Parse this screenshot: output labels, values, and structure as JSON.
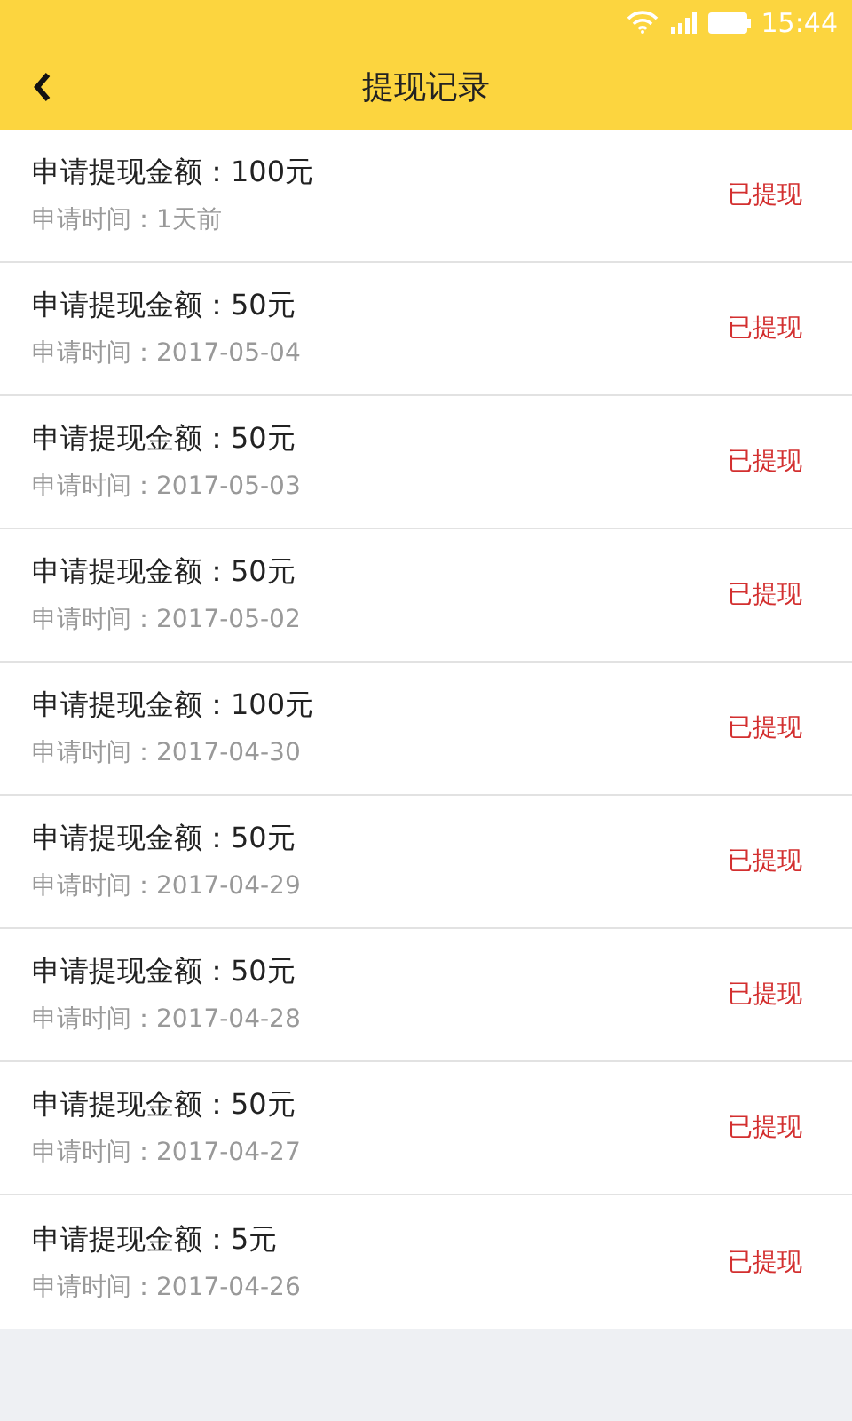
{
  "status_bar": {
    "time": "15:44"
  },
  "app_bar": {
    "title": "提现记录"
  },
  "records": [
    {
      "amount": "申请提现金额：100元",
      "time": "申请时间：1天前",
      "status": "已提现"
    },
    {
      "amount": "申请提现金额：50元",
      "time": "申请时间：2017-05-04",
      "status": "已提现"
    },
    {
      "amount": "申请提现金额：50元",
      "time": "申请时间：2017-05-03",
      "status": "已提现"
    },
    {
      "amount": "申请提现金额：50元",
      "time": "申请时间：2017-05-02",
      "status": "已提现"
    },
    {
      "amount": "申请提现金额：100元",
      "time": "申请时间：2017-04-30",
      "status": "已提现"
    },
    {
      "amount": "申请提现金额：50元",
      "time": "申请时间：2017-04-29",
      "status": "已提现"
    },
    {
      "amount": "申请提现金额：50元",
      "time": "申请时间：2017-04-28",
      "status": "已提现"
    },
    {
      "amount": "申请提现金额：50元",
      "time": "申请时间：2017-04-27",
      "status": "已提现"
    },
    {
      "amount": "申请提现金额：5元",
      "time": "申请时间：2017-04-26",
      "status": "已提现"
    }
  ]
}
